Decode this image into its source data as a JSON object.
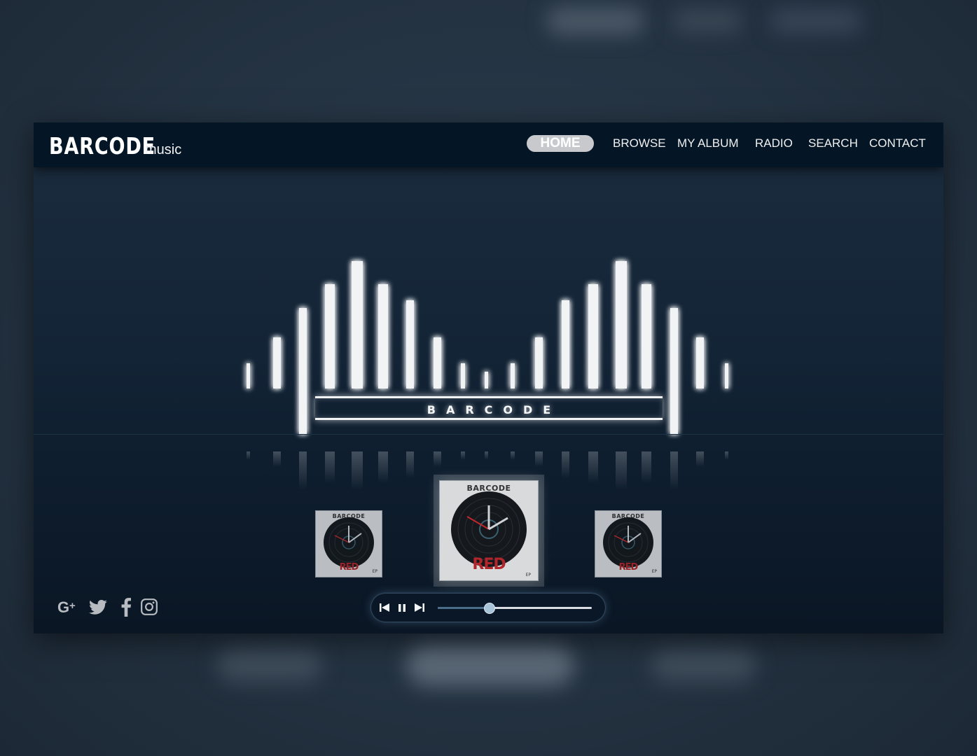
{
  "brand": {
    "name": "BARCODE",
    "tagline": "music"
  },
  "nav": {
    "items": [
      {
        "label": "HOME",
        "active": true
      },
      {
        "label": "BROWSE",
        "active": false
      },
      {
        "label": "MY ALBUM",
        "active": false
      },
      {
        "label": "RADIO",
        "active": false
      },
      {
        "label": "SEARCH",
        "active": false
      },
      {
        "label": "CONTACT",
        "active": false
      }
    ]
  },
  "hero": {
    "wordmark": "BARCODE",
    "equalizer_levels": [
      0.2,
      0.4,
      1,
      0.82,
      1,
      0.82,
      0.69,
      0.4,
      0.2,
      0.13,
      0.2,
      0.4,
      0.69,
      0.82,
      1,
      0.82,
      1,
      0.4,
      0.2
    ]
  },
  "albums": [
    {
      "brand": "BARCODE",
      "title": "RED",
      "subtitle": "EP",
      "position": "left"
    },
    {
      "brand": "BARCODE",
      "title": "RED",
      "subtitle": "EP",
      "position": "center"
    },
    {
      "brand": "BARCODE",
      "title": "RED",
      "subtitle": "EP",
      "position": "right"
    }
  ],
  "social": [
    "google-plus-icon",
    "twitter-icon",
    "facebook-icon",
    "instagram-icon"
  ],
  "player": {
    "progress": 0.33,
    "state": "playing"
  },
  "colors": {
    "accent": "#c7c9cc",
    "glow": "#ffffff",
    "header": "#041626",
    "record_red": "#b0262a"
  }
}
